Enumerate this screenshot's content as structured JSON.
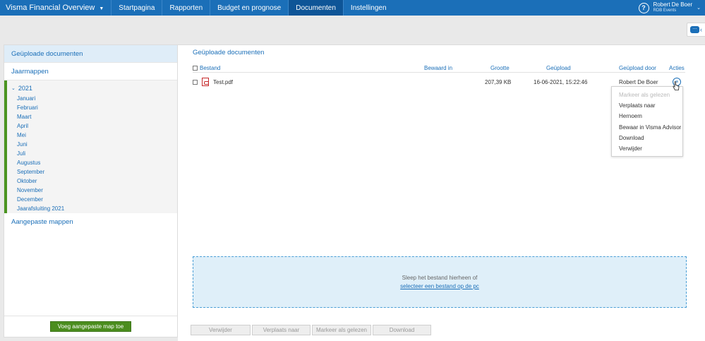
{
  "topnav": {
    "brand": "Visma Financial Overview",
    "tabs": [
      {
        "label": "Startpagina"
      },
      {
        "label": "Rapporten"
      },
      {
        "label": "Budget en prognose"
      },
      {
        "label": "Documenten"
      },
      {
        "label": "Instellingen"
      }
    ],
    "active_tab": "Documenten",
    "user_name": "Robert De Boer",
    "user_org": "RDB Events",
    "help_icon": "question-circle-icon"
  },
  "chat": {
    "icon": "chat-bubble-icon"
  },
  "sidebar": {
    "uploaded": "Geüploade documenten",
    "yearfolders": "Jaarmappen",
    "year": "2021",
    "months": [
      "Januari",
      "Februari",
      "Maart",
      "April",
      "Mei",
      "Juni",
      "Juli",
      "Augustus",
      "September",
      "Oktober",
      "November",
      "December",
      "Jaarafsluiting 2021"
    ],
    "custom": "Aangepaste mappen",
    "add_button": "Voeg aangepaste map toe",
    "accent_color": "#4b9420"
  },
  "main": {
    "title": "Geüploade documenten",
    "columns": {
      "file": "Bestand",
      "stored_in": "Bewaard in",
      "size": "Grootte",
      "uploaded": "Geüpload",
      "uploaded_by": "Geüpload door",
      "actions": "Acties"
    },
    "rows": [
      {
        "file": "Test.pdf",
        "stored_in": "",
        "size": "207,39 KB",
        "uploaded": "16-06-2021, 15:22:46",
        "uploaded_by": "Robert De Boer"
      }
    ],
    "menu": [
      {
        "label": "Markeer als gelezen",
        "disabled": true
      },
      {
        "label": "Verplaats naar"
      },
      {
        "label": "Hernoem"
      },
      {
        "label": "Bewaar in Visma Advisor"
      },
      {
        "label": "Download"
      },
      {
        "label": "Verwijder"
      }
    ],
    "dropzone": {
      "text": "Sleep het bestand hierheen of",
      "link": "selecteer een bestand op de pc"
    },
    "buttons": [
      "Verwijder",
      "Verplaats naar",
      "Markeer als gelezen",
      "Download"
    ]
  },
  "colors": {
    "brand_blue": "#1b6fb8",
    "active_tab": "#0e5597",
    "green": "#4b8d1e"
  }
}
